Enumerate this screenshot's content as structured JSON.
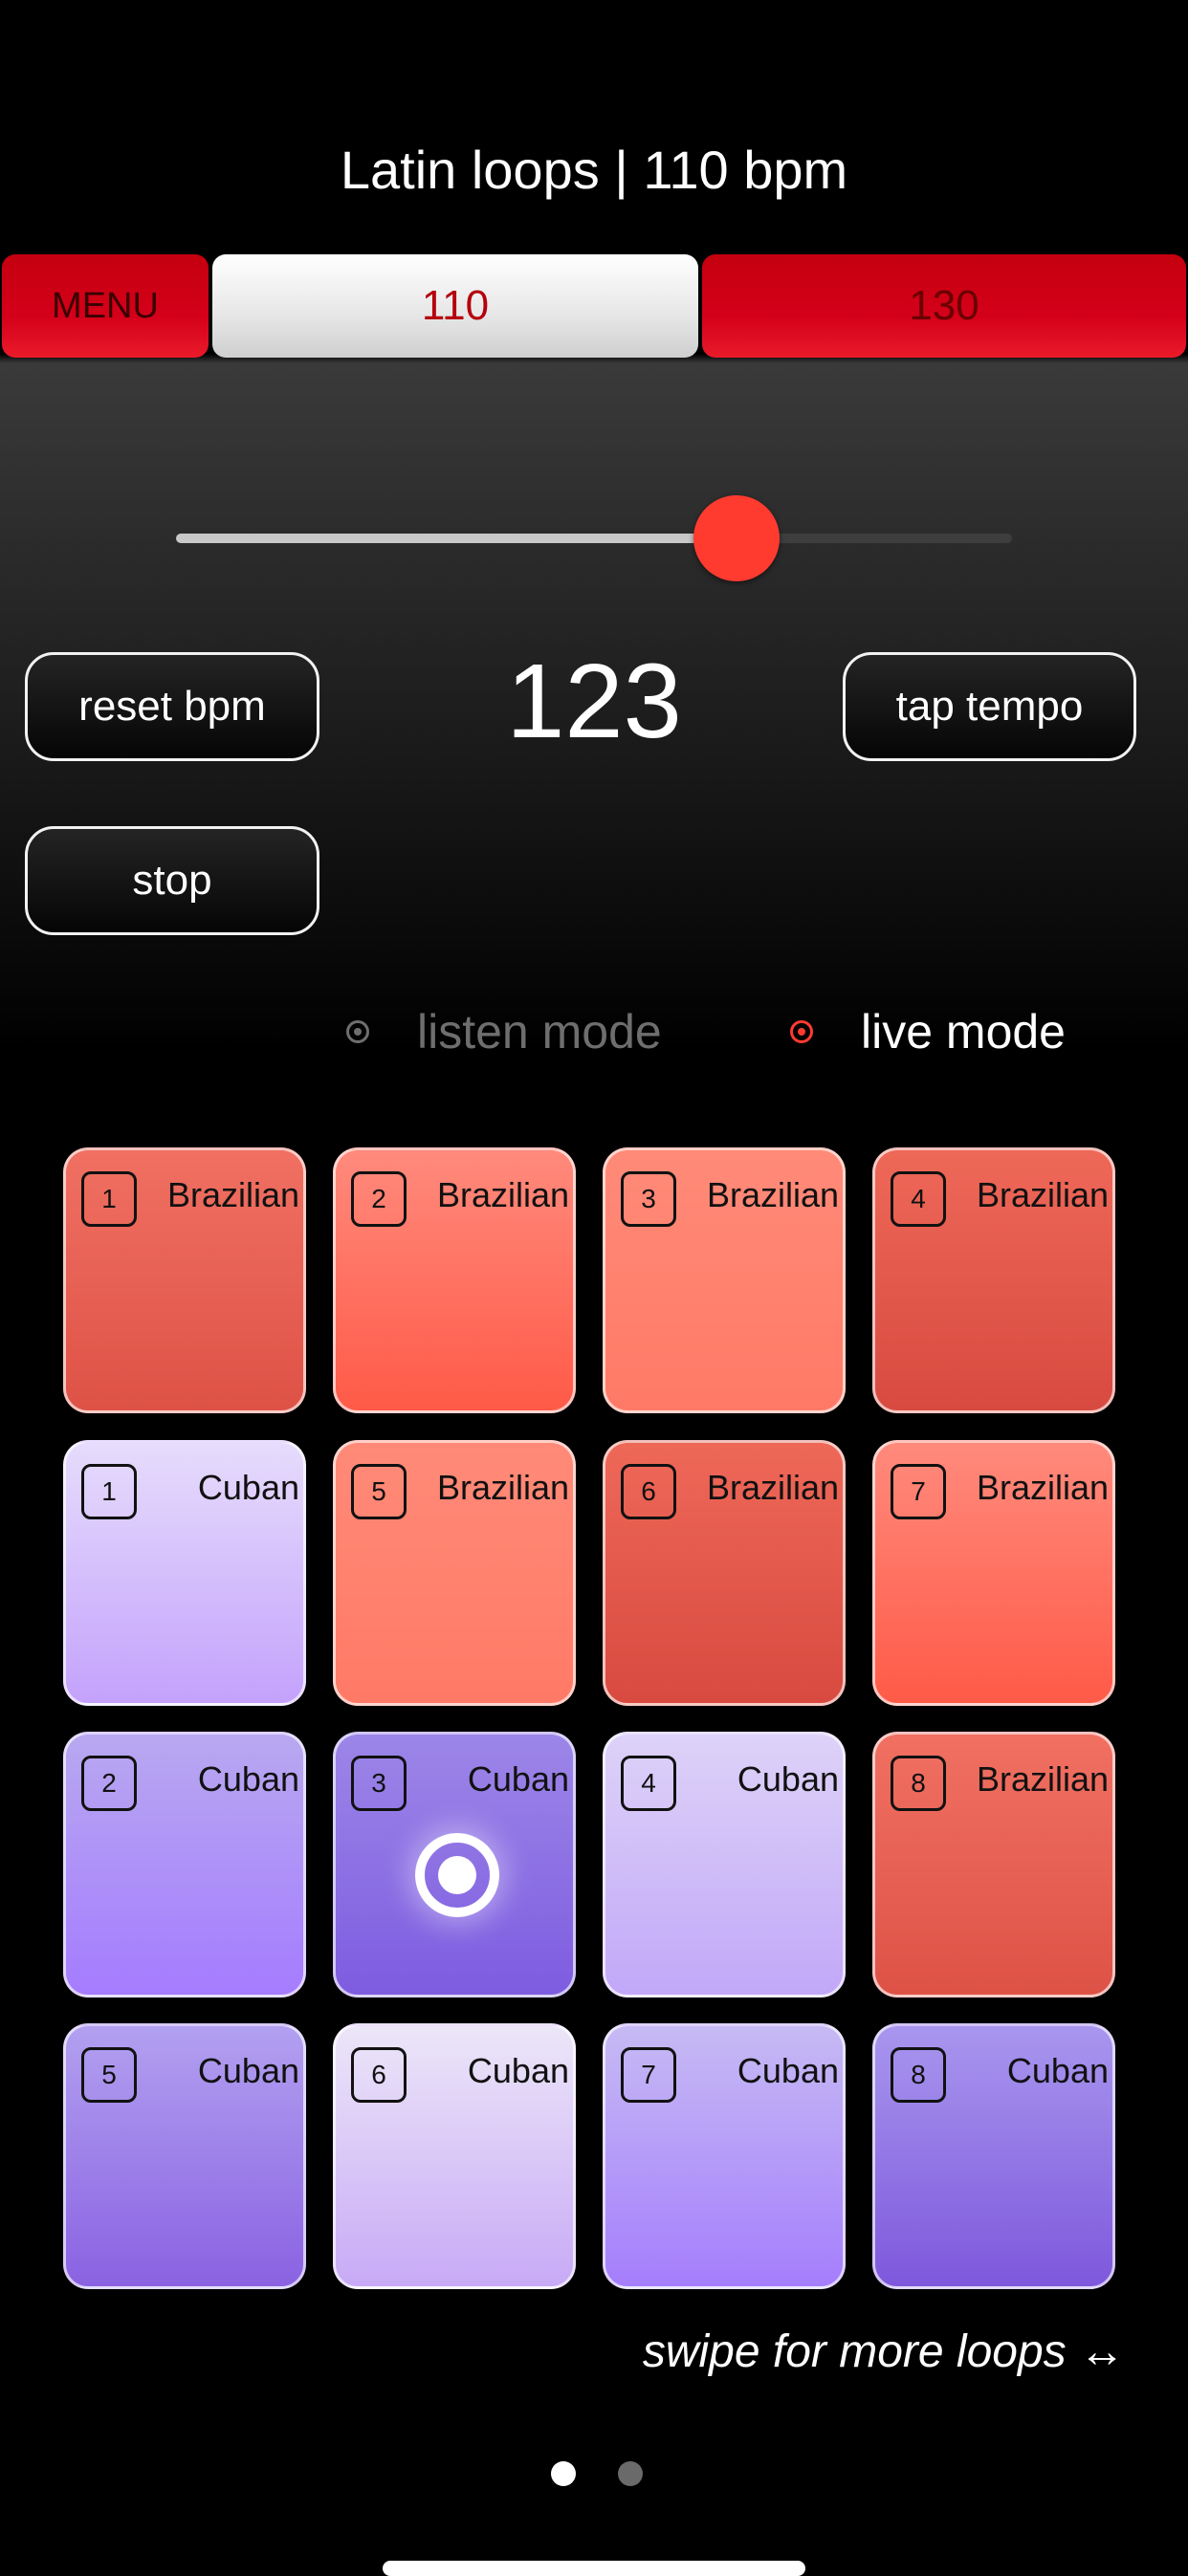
{
  "header": {
    "title": "Latin loops | 110 bpm"
  },
  "tabs": {
    "menu": "MENU",
    "tempo_a": "110",
    "tempo_b": "130"
  },
  "tempo": {
    "value": "123",
    "slider_level": 0.67
  },
  "buttons": {
    "reset": "reset bpm",
    "tap": "tap tempo",
    "stop": "stop"
  },
  "modes": {
    "listen": "listen mode",
    "live": "live mode",
    "active": "live"
  },
  "pads": [
    {
      "num": "1",
      "label": "Brazilian",
      "style": "bra1"
    },
    {
      "num": "2",
      "label": "Brazilian",
      "style": "bra2"
    },
    {
      "num": "3",
      "label": "Brazilian",
      "style": "bra3"
    },
    {
      "num": "4",
      "label": "Brazilian",
      "style": "bra4"
    },
    {
      "num": "1",
      "label": "Cuban",
      "style": "cub1"
    },
    {
      "num": "5",
      "label": "Brazilian",
      "style": "bra3"
    },
    {
      "num": "6",
      "label": "Brazilian",
      "style": "bra4"
    },
    {
      "num": "7",
      "label": "Brazilian",
      "style": "bra2"
    },
    {
      "num": "2",
      "label": "Cuban",
      "style": "cub2"
    },
    {
      "num": "3",
      "label": "Cuban",
      "style": "cub3",
      "playing": true
    },
    {
      "num": "4",
      "label": "Cuban",
      "style": "cub4"
    },
    {
      "num": "8",
      "label": "Brazilian",
      "style": "bra1"
    },
    {
      "num": "5",
      "label": "Cuban",
      "style": "cub5"
    },
    {
      "num": "6",
      "label": "Cuban",
      "style": "cub6"
    },
    {
      "num": "7",
      "label": "Cuban",
      "style": "cub7"
    },
    {
      "num": "8",
      "label": "Cuban",
      "style": "cub8"
    }
  ],
  "footer": {
    "swipe": "swipe for more loops ↔"
  },
  "pager": {
    "current": 1,
    "total": 2
  },
  "colors": {
    "accent_red": "#ff3b30",
    "tab_red": "#d4001a",
    "inactive_text": "#6e6e6e"
  }
}
